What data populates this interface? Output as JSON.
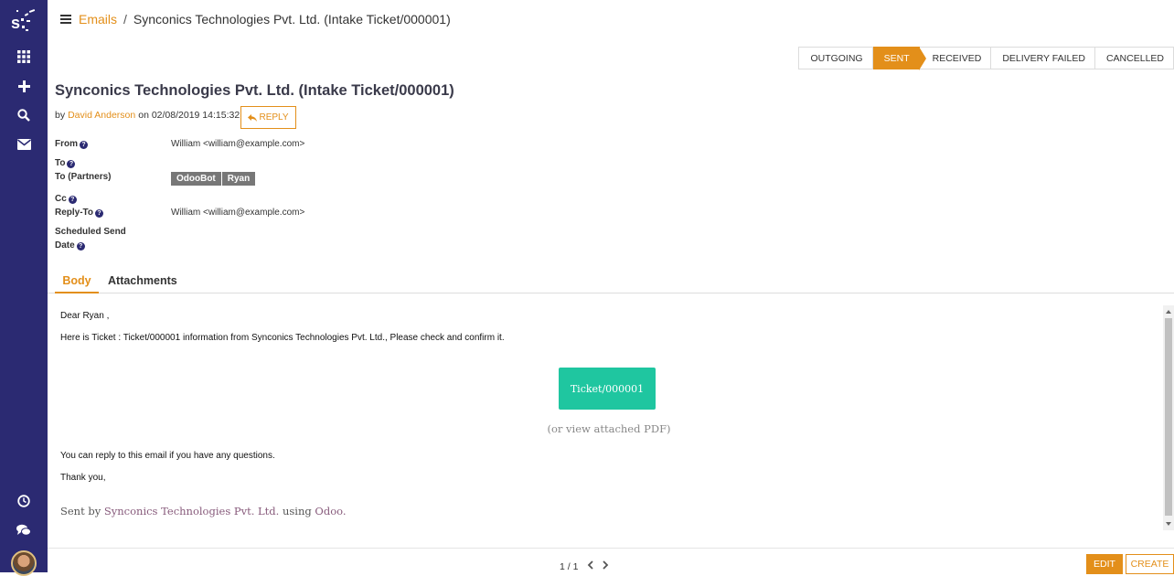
{
  "breadcrumb": {
    "parent": "Emails",
    "separator": "/",
    "current": "Synconics Technologies Pvt. Ltd. (Intake Ticket/000001)"
  },
  "statusbar": {
    "stages": [
      "OUTGOING",
      "SENT",
      "RECEIVED",
      "DELIVERY FAILED",
      "CANCELLED"
    ],
    "active": "SENT"
  },
  "record": {
    "title": "Synconics Technologies Pvt. Ltd. (Intake Ticket/000001)",
    "by": "by",
    "author": "David Anderson",
    "on_date": "on 02/08/2019 14:15:32",
    "reply_label": "REPLY"
  },
  "fields": {
    "from_label": "From",
    "from_value": "William <william@example.com>",
    "to_label": "To",
    "to_partners_label": "To (Partners)",
    "partners": [
      "OdooBot",
      "Ryan"
    ],
    "cc_label": "Cc",
    "reply_to_label": "Reply-To",
    "reply_to_value": "William <william@example.com>",
    "scheduled_label_1": "Scheduled Send",
    "scheduled_label_2": "Date",
    "help_glyph": "?"
  },
  "tabs": [
    {
      "label": "Body",
      "active": true
    },
    {
      "label": "Attachments",
      "active": false
    }
  ],
  "body": {
    "greeting": "Dear Ryan ,",
    "line1": "Here is Ticket : Ticket/000001 information from Synconics Technologies Pvt. Ltd., Please check and confirm it.",
    "ticket_button": "Ticket/000001",
    "pdf_note": "(or view attached PDF)",
    "line2": "You can reply to this email if you have any questions.",
    "thanks": "Thank you,",
    "sent_by_prefix": "Sent by",
    "sent_by_company": "Synconics Technologies Pvt. Ltd.",
    "sent_by_using": "using",
    "sent_by_odoo": "Odoo."
  },
  "pager": {
    "value": "1 / 1"
  },
  "buttons": {
    "edit": "EDIT",
    "create": "CREATE"
  },
  "colors": {
    "brand": "#e38f1a",
    "sidebar": "#2b2a72",
    "ticket_button": "#1fc6a0"
  }
}
